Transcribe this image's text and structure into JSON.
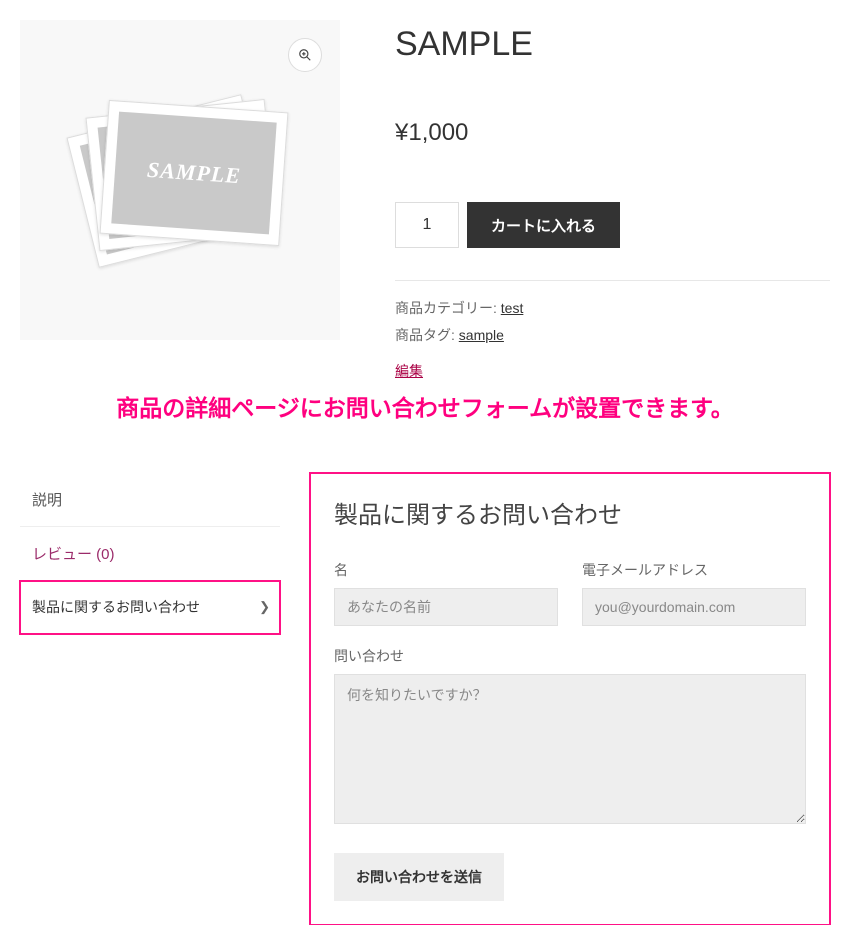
{
  "product": {
    "image_text": "SAMPLE",
    "title": "SAMPLE",
    "price": "¥1,000",
    "quantity": "1",
    "add_to_cart_label": "カートに入れる"
  },
  "meta": {
    "category_label": "商品カテゴリー:",
    "category_link": "test",
    "tag_label": "商品タグ:",
    "tag_link": "sample",
    "edit_label": "編集"
  },
  "annotation": "商品の詳細ページにお問い合わせフォームが設置できます。",
  "tabs": {
    "description": "説明",
    "reviews": "レビュー (0)",
    "inquiry": "製品に関するお問い合わせ"
  },
  "form": {
    "title": "製品に関するお問い合わせ",
    "name_label": "名",
    "name_placeholder": "あなたの名前",
    "email_label": "電子メールアドレス",
    "email_placeholder": "you@yourdomain.com",
    "message_label": "問い合わせ",
    "message_placeholder": "何を知りたいですか？",
    "submit_label": "お問い合わせを送信"
  }
}
